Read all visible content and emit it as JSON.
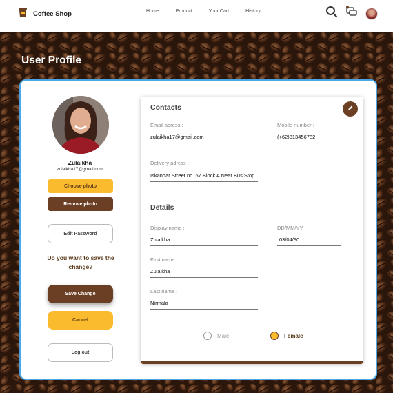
{
  "header": {
    "app_title": "Coffee Shop",
    "nav": [
      "Home",
      "Product",
      "Your Cart",
      "History"
    ],
    "icons": [
      "search-icon",
      "chat-icon",
      "avatar"
    ]
  },
  "page": {
    "title": "User Profile"
  },
  "profile": {
    "name": "Zulaikha",
    "email": "zulaikha17@gmail.com",
    "choose_photo": "Choose photo",
    "remove_photo": "Remove photo",
    "edit_password": "Edit Password",
    "question": "Do you want to save the change?",
    "save": "Save Change",
    "cancel": "Cancel",
    "logout": "Log out"
  },
  "contacts": {
    "title": "Contacts",
    "email_label": "Email adress :",
    "email_value": "zulaikha17@gmail.com",
    "mobile_label": "Mobile number :",
    "mobile_value": "(+62)813456782",
    "delivery_label": "Delivery adress :",
    "delivery_value": "Iskandar Street no. 67 Block A Near Bus Stop"
  },
  "details": {
    "title": "Details",
    "display_label": "Display name :",
    "display_value": "Zulaikha",
    "dob_label": "DD/MM/YY",
    "dob_value": "03/04/90",
    "first_label": "First name :",
    "first_value": "Zulaikha",
    "last_label": "Last name :",
    "last_value": "Nirmala",
    "gender_options": [
      "Male",
      "Female"
    ],
    "gender_selected": "Female"
  },
  "colors": {
    "brown": "#6b3f24",
    "yellow": "#fbbb2e",
    "border_blue": "#4aa6e6"
  }
}
